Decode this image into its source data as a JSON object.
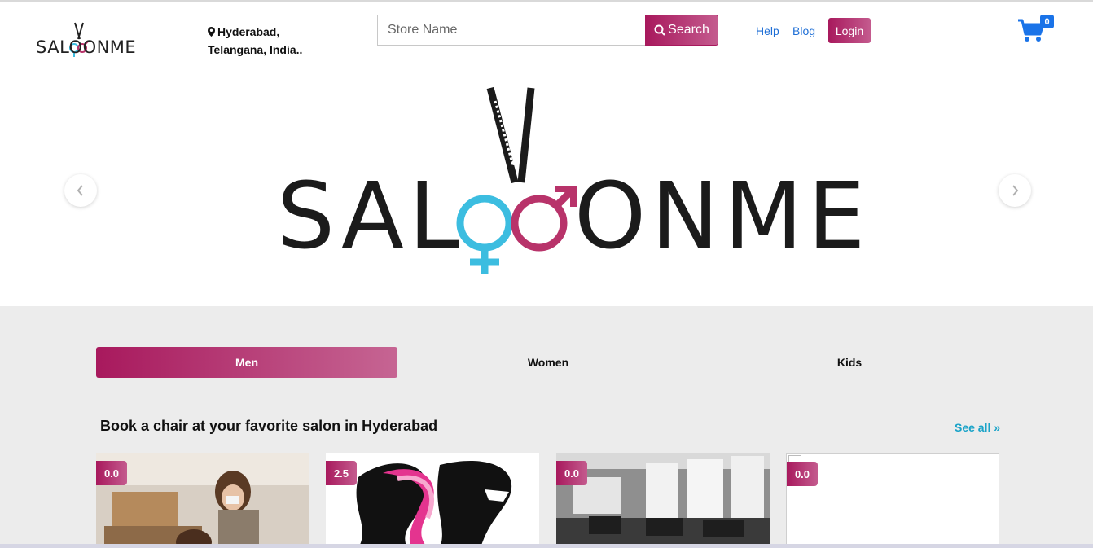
{
  "header": {
    "brand": "SALOONME",
    "location_line1": "Hyderabad,",
    "location_line2": "Telangana, India..",
    "search_placeholder": "Store Name",
    "search_button": "Search",
    "help": "Help",
    "blog": "Blog",
    "login": "Login",
    "cart_count": "0"
  },
  "hero": {
    "brand": "SALOONME",
    "prev_icon": "chevron-left-icon",
    "next_icon": "chevron-right-icon"
  },
  "tabs": [
    {
      "label": "Men",
      "active": true
    },
    {
      "label": "Women",
      "active": false
    },
    {
      "label": "Kids",
      "active": false
    }
  ],
  "section": {
    "title": "Book a chair at your favorite salon in Hyderabad",
    "see_all": "See all »"
  },
  "cards": [
    {
      "rating": "0.0",
      "image": "salon-interior-photo"
    },
    {
      "rating": "2.5",
      "image": "salon-logo-silhouettes"
    },
    {
      "rating": "0.0",
      "image": "salon-bw-interior-photo"
    },
    {
      "rating": "0.0",
      "image": "broken-image"
    }
  ],
  "colors": {
    "accent": "#a8195d",
    "accent_light": "#c45b8e",
    "link": "#1f6fd6",
    "cart": "#1a73e8",
    "see_all": "#1aa3c8",
    "section_bg": "#ececec"
  }
}
